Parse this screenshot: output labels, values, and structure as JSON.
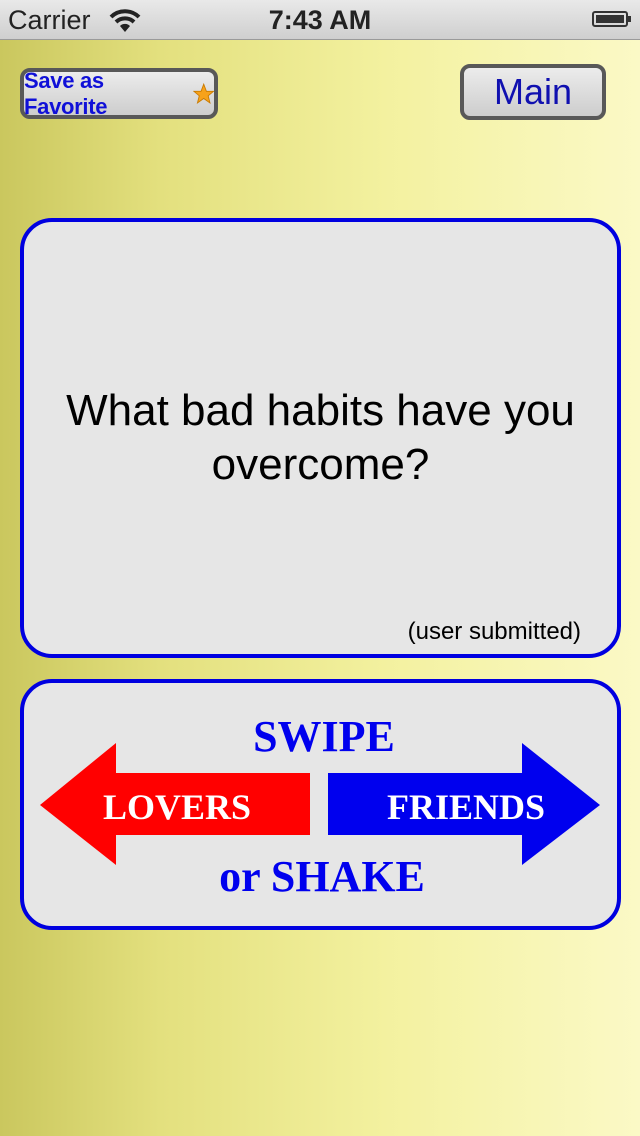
{
  "status_bar": {
    "carrier": "Carrier",
    "time": "7:43 AM"
  },
  "toolbar": {
    "favorite_label": "Save as Favorite",
    "favorite_icon": "star-icon",
    "main_label": "Main"
  },
  "question": {
    "text": "What bad habits have you overcome?",
    "attribution": "(user submitted)"
  },
  "instructions": {
    "top": "SWIPE",
    "left_label": "LOVERS",
    "right_label": "FRIENDS",
    "bottom": "or SHAKE",
    "left_color": "#ff0000",
    "right_color": "#0000ee",
    "text_color": "#0000ee"
  }
}
